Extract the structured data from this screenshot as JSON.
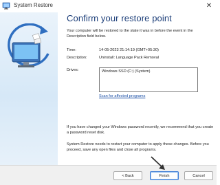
{
  "window": {
    "title": "System Restore"
  },
  "titlebar": {
    "close_glyph": "✕"
  },
  "page": {
    "heading": "Confirm your restore point",
    "intro": "Your computer will be restored to the state it was in before the event in the Description field below.",
    "time_label": "Time:",
    "time_value": "14-05-2023 21:14:19 (GMT+05:30)",
    "description_label": "Description:",
    "description_value": "Uninstall: Language Pack Removal",
    "drives_label": "Drives:",
    "drives": [
      "Windows SSD (C:) (System)"
    ],
    "scan_link": "Scan for affected programs",
    "password_note": "If you have changed your Windows password recently, we recommend that you create a password reset disk.",
    "restart_note": "System Restore needs to restart your computer to apply these changes. Before you proceed, save any open files and close all programs."
  },
  "footer": {
    "back_label": "< Back",
    "finish_label": "Finish",
    "cancel_label": "Cancel"
  },
  "icons": {
    "app": "system-restore-icon",
    "sidebar": "restore-computer-illustration",
    "annotation": "pointer-arrow"
  },
  "colors": {
    "heading": "#1b3d78",
    "link": "#1a4fa6",
    "primary_border": "#3c7bd6"
  }
}
